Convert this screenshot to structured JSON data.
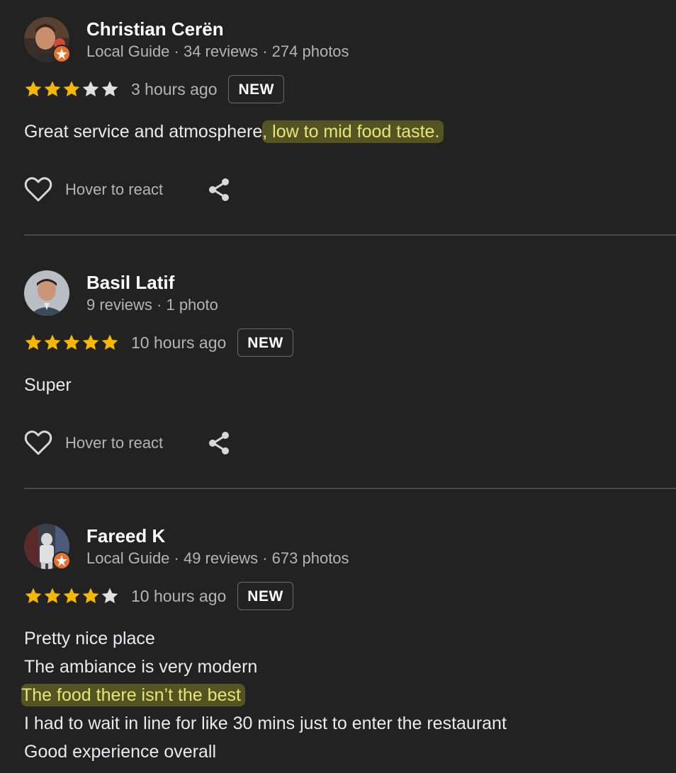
{
  "colors": {
    "background": "#222222",
    "star_filled": "#f5b800",
    "star_empty": "#e0e0e0",
    "highlight_text": "#e9e47a",
    "local_guide_badge": "#e8702a"
  },
  "reviews": [
    {
      "name": "Christian Cerën",
      "meta": "Local Guide · 34 reviews · 274 photos",
      "rating": 3,
      "time": "3 hours ago",
      "badge": "NEW",
      "text_plain": "Great service and atmosphere",
      "text_highlight": ", low to mid food taste.",
      "react_label": "Hover to react",
      "avatar_icon": "user-photo",
      "local_guide_icon": "star-badge-icon"
    },
    {
      "name": "Basil Latif",
      "meta": "9 reviews · 1 photo",
      "rating": 5,
      "time": "10 hours ago",
      "badge": "NEW",
      "text_plain": "Super",
      "react_label": "Hover to react",
      "avatar_icon": "user-photo"
    },
    {
      "name": "Fareed K",
      "meta": "Local Guide · 49 reviews · 673 photos",
      "rating": 4,
      "time": "10 hours ago",
      "badge": "NEW",
      "lines": [
        "Pretty nice place",
        "The ambiance is very modern",
        "The food there isn’t the best",
        "I had to wait in line for like 30 mins just to enter the restaurant",
        "Good experience overall"
      ],
      "highlight_line_index": 2,
      "avatar_icon": "user-photo",
      "local_guide_icon": "star-badge-icon"
    }
  ]
}
